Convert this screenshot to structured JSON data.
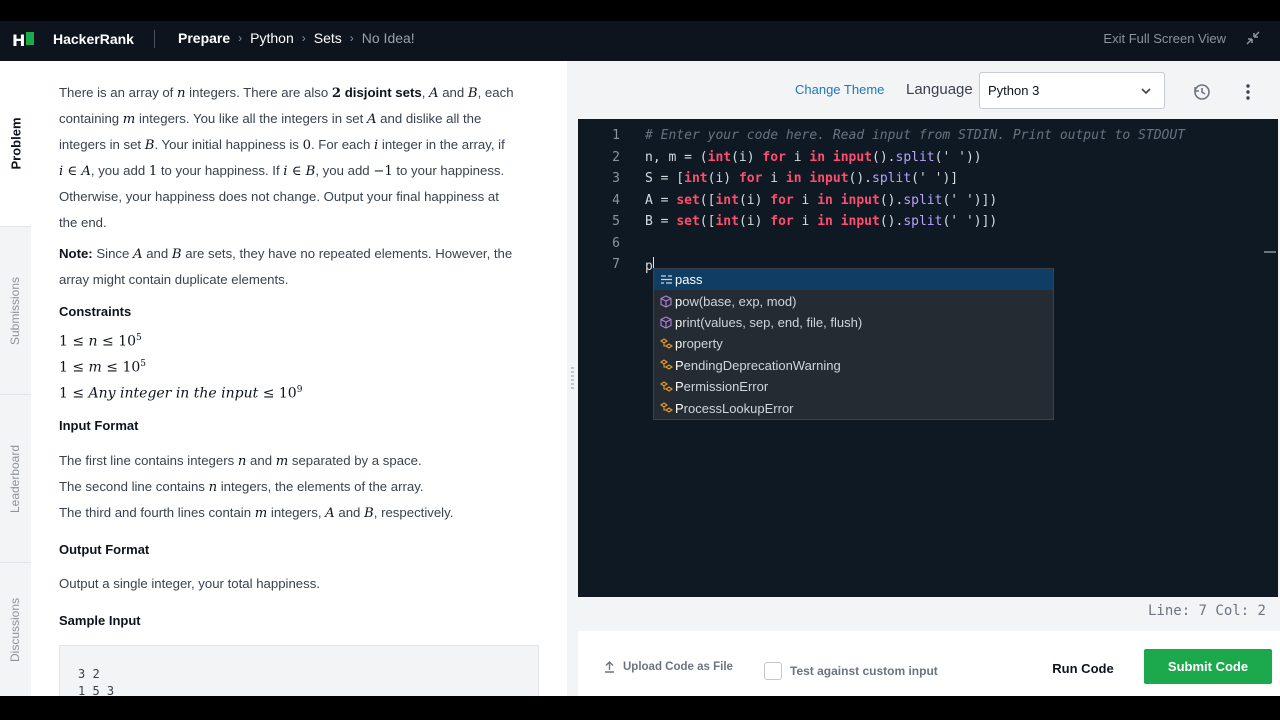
{
  "nav": {
    "logo_letter": "H",
    "brand": "HackerRank",
    "breadcrumb": [
      "Prepare",
      "Python",
      "Sets",
      "No Idea!"
    ],
    "exit_fullscreen": "Exit Full Screen View"
  },
  "sidebar_tabs": [
    "Problem",
    "Submissions",
    "Leaderboard",
    "Discussions"
  ],
  "problem": {
    "para1": {
      "t1": "There is an array of ",
      "n": "n",
      "t2": " integers. There are also ",
      "two": "2",
      "disjoint": "disjoint sets",
      "t3": ", ",
      "A": "A",
      "t4": " and ",
      "B": "B",
      "t5": ", each",
      "line2_t1": "containing ",
      "m": "m",
      "line2_t2": " integers. You like all the integers in set ",
      "line2_t3": " and dislike all the",
      "line3_t1": "integers in set ",
      "line3_t2": ". Your initial happiness is ",
      "zero": "0",
      "line3_t3": ". For each ",
      "i": "i",
      "line3_t4": " integer in the array, if",
      "line4_m1": "i ∈ A",
      "line4_t1": ", you add ",
      "one": "1",
      "line4_t2": " to your happiness. If ",
      "line4_m2": "i ∈ B",
      "line4_t3": ", you add ",
      "minus_one": "−1",
      "line4_t4": " to your happiness.",
      "line5": "Otherwise, your happiness does not change. Output your final happiness at",
      "line6": "the end."
    },
    "note": {
      "label": "Note:",
      "t1": " Since ",
      "A": "A",
      "t2": " and ",
      "B": "B",
      "t3": " are sets, they have no repeated elements. However, the",
      "line2": "array might contain duplicate elements."
    },
    "constraints_title": "Constraints",
    "constraints": [
      {
        "lhs": "1 ≤ ",
        "var": "n",
        "rel": " ≤ 10",
        "exp": "5"
      },
      {
        "lhs": "1 ≤ ",
        "var": "m",
        "rel": " ≤ 10",
        "exp": "5"
      },
      {
        "lhs": "1 ≤ ",
        "var": "Any integer in the input",
        "rel": " ≤ 10",
        "exp": "9"
      }
    ],
    "input_format_title": "Input Format",
    "input_format": {
      "l1_t1": "The first line contains integers ",
      "l1_n": "n",
      "l1_t2": " and ",
      "l1_m": "m",
      "l1_t3": " separated by a space.",
      "l2_t1": "The second line contains ",
      "l2_n": "n",
      "l2_t2": " integers, the elements of the array.",
      "l3_t1": "The third and fourth lines contain ",
      "l3_m": "m",
      "l3_t2": " integers, ",
      "l3_A": "A",
      "l3_t3": " and ",
      "l3_B": "B",
      "l3_t4": ", respectively."
    },
    "output_format_title": "Output Format",
    "output_format": "Output a single integer, your total happiness.",
    "sample_input_title": "Sample Input",
    "sample_input": "3 2\n1 5 3"
  },
  "toolbar": {
    "change_theme": "Change Theme",
    "language_label": "Language",
    "language_value": "Python 3"
  },
  "editor": {
    "line_numbers": [
      "1",
      "2",
      "3",
      "4",
      "5",
      "6",
      "7"
    ],
    "typed": "p",
    "suggestions": [
      {
        "icon": "keyword-icon",
        "match": "p",
        "rest": "ass",
        "selected": true
      },
      {
        "icon": "method-cube-icon",
        "match": "p",
        "rest": "ow(base, exp, mod)",
        "selected": false
      },
      {
        "icon": "method-cube-icon",
        "match": "p",
        "rest": "rint(values, sep, end, file, flush)",
        "selected": false
      },
      {
        "icon": "class-icon",
        "match": "p",
        "rest": "roperty",
        "selected": false
      },
      {
        "icon": "class-icon",
        "match": "P",
        "rest": "endingDeprecationWarning",
        "selected": false
      },
      {
        "icon": "class-icon",
        "match": "P",
        "rest": "ermissionError",
        "selected": false
      },
      {
        "icon": "class-icon",
        "match": "P",
        "rest": "rocessLookupError",
        "selected": false
      }
    ],
    "status": "Line: 7 Col: 2"
  },
  "actions": {
    "upload": "Upload Code as File",
    "test_custom": "Test against custom input",
    "run": "Run Code",
    "submit": "Submit Code"
  },
  "colors": {
    "brand_green": "#1ba94c",
    "nav_bg": "#0e141e",
    "editor_bg": "#0f1923",
    "link_blue": "#1f76bd"
  }
}
